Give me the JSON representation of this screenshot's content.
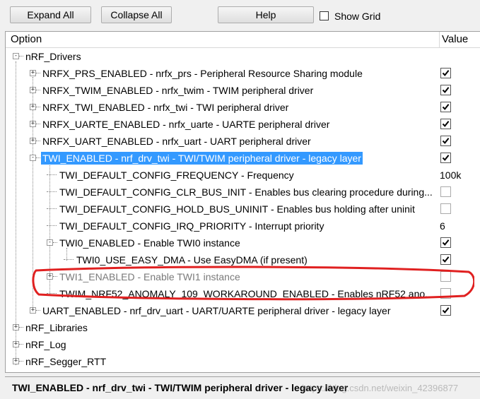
{
  "toolbar": {
    "expand_all": "Expand All",
    "collapse_all": "Collapse All",
    "help": "Help",
    "show_grid": "Show Grid"
  },
  "header": {
    "option": "Option",
    "value": "Value"
  },
  "tree": [
    {
      "label": "nRF_Drivers",
      "expanded": true
    },
    {
      "label": "NRFX_PRS_ENABLED - nrfx_prs - Peripheral Resource Sharing module",
      "value": "checked"
    },
    {
      "label": "NRFX_TWIM_ENABLED - nrfx_twim - TWIM peripheral driver",
      "value": "checked"
    },
    {
      "label": "NRFX_TWI_ENABLED - nrfx_twi - TWI peripheral driver",
      "value": "checked"
    },
    {
      "label": "NRFX_UARTE_ENABLED - nrfx_uarte - UARTE peripheral driver",
      "value": "checked"
    },
    {
      "label": "NRFX_UART_ENABLED - nrfx_uart - UART peripheral driver",
      "value": "checked"
    },
    {
      "label": "TWI_ENABLED - nrf_drv_twi - TWI/TWIM peripheral driver - legacy layer",
      "value": "checked",
      "selected": true
    },
    {
      "label": "TWI_DEFAULT_CONFIG_FREQUENCY  - Frequency",
      "value": "100k"
    },
    {
      "label": "TWI_DEFAULT_CONFIG_CLR_BUS_INIT  - Enables bus clearing procedure during...",
      "value": "unchecked"
    },
    {
      "label": "TWI_DEFAULT_CONFIG_HOLD_BUS_UNINIT  - Enables bus holding after uninit",
      "value": "unchecked"
    },
    {
      "label": "TWI_DEFAULT_CONFIG_IRQ_PRIORITY  - Interrupt priority",
      "value": "6"
    },
    {
      "label": "TWI0_ENABLED - Enable TWI0 instance",
      "value": "checked"
    },
    {
      "label": "TWI0_USE_EASY_DMA  - Use EasyDMA (if present)",
      "value": "checked"
    },
    {
      "label": "TWI1_ENABLED - Enable TWI1 instance",
      "value": "unchecked",
      "disabled": true
    },
    {
      "label": "TWIM_NRF52_ANOMALY_109_WORKAROUND_ENABLED  - Enables nRF52 ano...",
      "value": "unchecked"
    },
    {
      "label": "UART_ENABLED - nrf_drv_uart - UART/UARTE peripheral driver - legacy layer",
      "value": "checked"
    },
    {
      "label": "nRF_Libraries"
    },
    {
      "label": "nRF_Log"
    },
    {
      "label": "nRF_Segger_RTT"
    }
  ],
  "status_text": "TWI_ENABLED - nrf_drv_twi - TWI/TWIM peripheral driver - legacy layer",
  "watermark": "https://blog.csdn.net/weixin_42396877",
  "colors": {
    "selection": "#3399ff",
    "annotation": "#e02020"
  }
}
